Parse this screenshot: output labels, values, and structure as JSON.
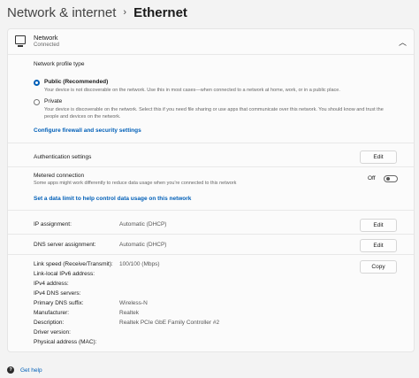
{
  "header": {
    "breadcrumb_root": "Network & internet",
    "chevron": "›",
    "current": "Ethernet"
  },
  "network": {
    "title": "Network",
    "status": "Connected",
    "icon": "ethernet-icon"
  },
  "profile": {
    "heading": "Network profile type",
    "public_label": "Public (Recommended)",
    "public_desc": "Your device is not discoverable on the network. Use this in most cases—when connected to a network at home, work, or in a public place.",
    "private_label": "Private",
    "private_desc_1": "Your device is discoverable on the network. Select this if you need file sharing or use apps that communicate over this network. You should know and trust the",
    "private_desc_2": "people and devices on the network.",
    "selected": "public",
    "firewall_link": "Configure firewall and security settings"
  },
  "auth": {
    "label": "Authentication settings",
    "button": "Edit"
  },
  "metered": {
    "label": "Metered connection",
    "desc": "Some apps might work differently to reduce data usage when you're connected to this network",
    "state": "Off",
    "data_limit_link": "Set a data limit to help control data usage on this network"
  },
  "ip": {
    "label": "IP assignment:",
    "value": "Automatic (DHCP)",
    "button": "Edit"
  },
  "dns": {
    "label": "DNS server assignment:",
    "value": "Automatic (DHCP)",
    "button": "Edit"
  },
  "properties": {
    "copy_button": "Copy",
    "rows": [
      {
        "label": "Link speed (Receive/Transmit):",
        "value": "100/100 (Mbps)"
      },
      {
        "label": "Link-local IPv6 address:",
        "value": ""
      },
      {
        "label": "IPv4 address:",
        "value": ""
      },
      {
        "label": "IPv4 DNS servers:",
        "value": ""
      },
      {
        "label": "Primary DNS suffix:",
        "value": "Wireless-N"
      },
      {
        "label": "Manufacturer:",
        "value": "Realtek"
      },
      {
        "label": "Description:",
        "value": "Realtek PCIe GbE Family Controller #2"
      },
      {
        "label": "Driver version:",
        "value": ""
      },
      {
        "label": "Physical address (MAC):",
        "value": ""
      }
    ]
  },
  "footer": {
    "help": "Get help"
  },
  "colors": {
    "accent": "#005fb8",
    "background": "#f3f3f3",
    "panel": "#fbfbfb"
  }
}
